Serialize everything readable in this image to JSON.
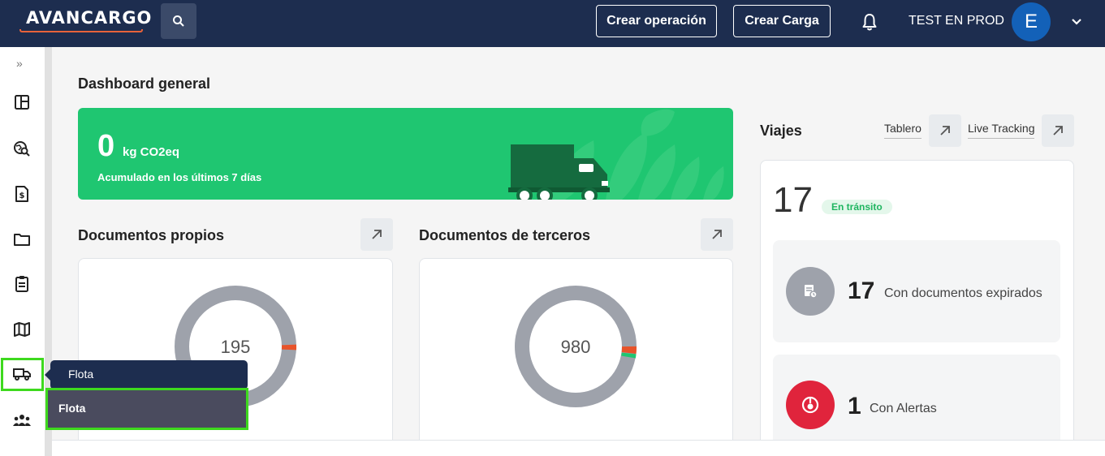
{
  "header": {
    "logo": "AVANCARGO",
    "create_operation": "Crear operación",
    "create_load": "Crear Carga",
    "user_name": "TEST EN PROD",
    "avatar_initial": "E"
  },
  "sidebar": {
    "expand": "»",
    "items": [
      "dashboard-icon",
      "search-globe-icon",
      "invoice-icon",
      "folder-icon",
      "clipboard-icon",
      "map-icon",
      "truck-icon",
      "users-icon"
    ]
  },
  "page": {
    "title": "Dashboard general"
  },
  "co2": {
    "value": "0",
    "unit": "kg CO2eq",
    "subtitle": "Acumulado en los últimos 7 días"
  },
  "documents_own": {
    "title": "Documentos propios",
    "total": "195"
  },
  "documents_third": {
    "title": "Documentos de terceros",
    "total": "980"
  },
  "trips": {
    "title": "Viajes",
    "link_board": "Tablero",
    "link_tracking": "Live Tracking",
    "in_transit_count": "17",
    "in_transit_label": "En tránsito",
    "expired_count": "17",
    "expired_label": "Con documentos expirados",
    "alerts_count": "1",
    "alerts_label": "Con Alertas"
  },
  "fleet_menu": {
    "tooltip": "Flota",
    "sub_item": "Flota"
  },
  "colors": {
    "navy": "#1d2d4f",
    "green": "#1fc671",
    "highlight": "#3ed91e",
    "donut_gray": "#9ea2ab",
    "donut_orange": "#e8532a",
    "alert_red": "#e0243c"
  }
}
